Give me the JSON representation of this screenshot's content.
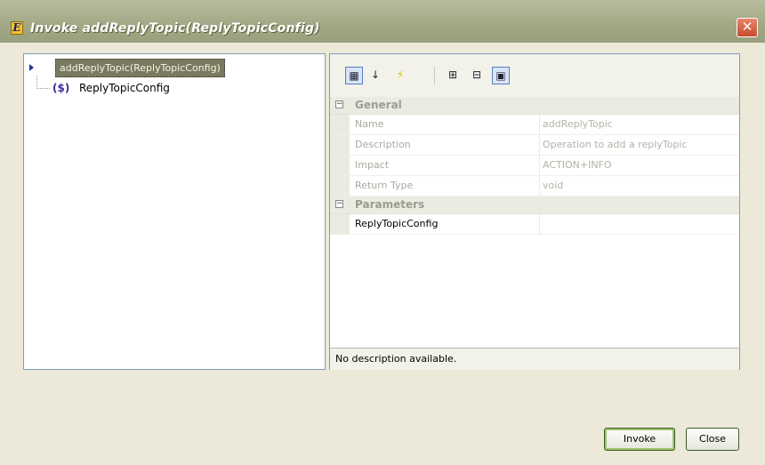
{
  "window": {
    "title": "Invoke addReplyTopic(ReplyTopicConfig)",
    "close_glyph": "✕"
  },
  "tree": {
    "root_label": "addReplyTopic(ReplyTopicConfig)",
    "child_icon_text": "($)",
    "child_label": "ReplyTopicConfig"
  },
  "toolbar": {
    "buttons": [
      {
        "icon": "categorized-icon",
        "glyph": "▦"
      },
      {
        "icon": "sort-alphabetical-icon",
        "glyph": "↓"
      },
      {
        "icon": "lightning-icon",
        "glyph": "⚡"
      },
      {
        "icon": "expand-all-icon",
        "glyph": "⊞"
      },
      {
        "icon": "collapse-all-icon",
        "glyph": "⊟"
      },
      {
        "icon": "property-pages-icon",
        "glyph": "▣"
      }
    ]
  },
  "properties": {
    "general_label": "General",
    "name_label": "Name",
    "name_value": "addReplyTopic",
    "description_label": "Description",
    "description_value": "Operation to add a replyTopic",
    "impact_label": "Impact",
    "impact_value": "ACTION+INFO",
    "return_type_label": "Return Type",
    "return_type_value": "void",
    "parameters_label": "Parameters",
    "param_name": "ReplyTopicConfig",
    "param_value": ""
  },
  "description_bar": {
    "text": "No description available."
  },
  "buttons": {
    "invoke": "Invoke",
    "close": "Close"
  }
}
